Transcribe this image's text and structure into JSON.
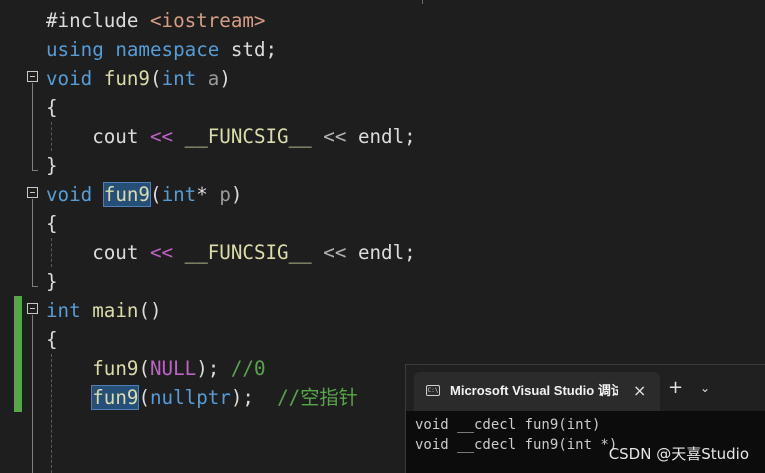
{
  "editor": {
    "lines": [
      [
        {
          "t": "#include ",
          "c": "plain"
        },
        {
          "t": "<iostream>",
          "c": "str"
        }
      ],
      [
        {
          "t": "using",
          "c": "kw"
        },
        {
          "t": " ",
          "c": "plain"
        },
        {
          "t": "namespace",
          "c": "kw"
        },
        {
          "t": " std;",
          "c": "plain"
        }
      ],
      [
        {
          "t": "void",
          "c": "kw"
        },
        {
          "t": " ",
          "c": "plain"
        },
        {
          "t": "fun9",
          "c": "fn"
        },
        {
          "t": "(",
          "c": "plain"
        },
        {
          "t": "int",
          "c": "kw"
        },
        {
          "t": " ",
          "c": "plain"
        },
        {
          "t": "a",
          "c": "param"
        },
        {
          "t": ")",
          "c": "plain"
        }
      ],
      [
        {
          "t": "{",
          "c": "plain"
        }
      ],
      [
        {
          "t": "    cout ",
          "c": "plain"
        },
        {
          "t": "<<",
          "c": "mac"
        },
        {
          "t": " ",
          "c": "plain"
        },
        {
          "t": "__FUNCSIG__",
          "c": "fn"
        },
        {
          "t": " ",
          "c": "plain"
        },
        {
          "t": "<<",
          "c": "op"
        },
        {
          "t": " endl;",
          "c": "plain"
        }
      ],
      [
        {
          "t": "}",
          "c": "plain"
        }
      ],
      [
        {
          "t": "void",
          "c": "kw"
        },
        {
          "t": " ",
          "c": "plain"
        },
        {
          "t": "fun9",
          "c": "fn",
          "hl": true
        },
        {
          "t": "(",
          "c": "plain"
        },
        {
          "t": "int",
          "c": "kw"
        },
        {
          "t": "* ",
          "c": "plain"
        },
        {
          "t": "p",
          "c": "param"
        },
        {
          "t": ")",
          "c": "plain"
        }
      ],
      [
        {
          "t": "{",
          "c": "plain"
        }
      ],
      [
        {
          "t": "    cout ",
          "c": "plain"
        },
        {
          "t": "<<",
          "c": "mac"
        },
        {
          "t": " ",
          "c": "plain"
        },
        {
          "t": "__FUNCSIG__",
          "c": "fn"
        },
        {
          "t": " ",
          "c": "plain"
        },
        {
          "t": "<<",
          "c": "op"
        },
        {
          "t": " endl;",
          "c": "plain"
        }
      ],
      [
        {
          "t": "}",
          "c": "plain"
        }
      ],
      [
        {
          "t": "int",
          "c": "kw"
        },
        {
          "t": " ",
          "c": "plain"
        },
        {
          "t": "main",
          "c": "fn"
        },
        {
          "t": "()",
          "c": "plain"
        }
      ],
      [
        {
          "t": "{",
          "c": "plain"
        }
      ],
      [
        {
          "t": "    ",
          "c": "plain"
        },
        {
          "t": "fun9",
          "c": "fn"
        },
        {
          "t": "(",
          "c": "plain"
        },
        {
          "t": "NULL",
          "c": "mac"
        },
        {
          "t": "); ",
          "c": "plain"
        },
        {
          "t": "//0",
          "c": "cmt"
        }
      ],
      [
        {
          "t": "    ",
          "c": "plain"
        },
        {
          "t": "fun9",
          "c": "fn",
          "hl": true
        },
        {
          "t": "(",
          "c": "plain"
        },
        {
          "t": "nullptr",
          "c": "kw"
        },
        {
          "t": ");  ",
          "c": "plain"
        },
        {
          "t": "//空指针",
          "c": "cmt"
        }
      ]
    ]
  },
  "console": {
    "icon_label": "C:\\",
    "title": "Microsoft Visual Studio 调试控制台",
    "close_icon": "×",
    "add_icon": "+",
    "dropdown_icon": "⌄",
    "output": [
      "void __cdecl fun9(int)",
      "void __cdecl fun9(int *)"
    ]
  },
  "watermark": "CSDN @天喜Studio"
}
